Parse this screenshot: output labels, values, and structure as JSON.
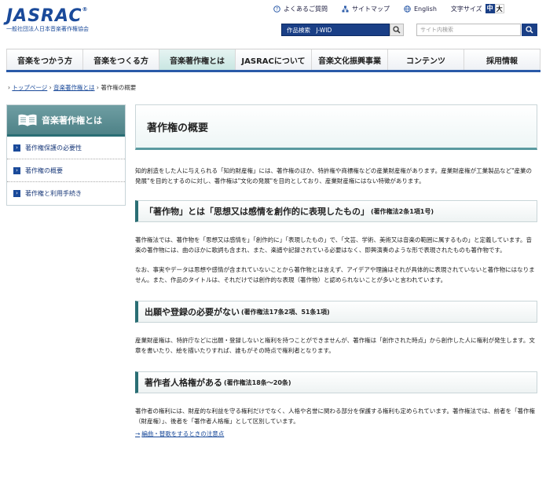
{
  "logo": {
    "main": "JASRAC",
    "mark": "®",
    "sub": "一般社団法人日本音楽著作権協会"
  },
  "toplinks": [
    {
      "icon": "question-icon",
      "label": "よくあるご質問"
    },
    {
      "icon": "sitemap-icon",
      "label": "サイトマップ"
    },
    {
      "icon": "globe-icon",
      "label": "English"
    }
  ],
  "fontsize": {
    "label": "文字サイズ",
    "mid": "中",
    "big": "大"
  },
  "search": {
    "works_label": "作品検索　J-WID",
    "site_placeholder": "サイト内検索"
  },
  "nav": [
    {
      "label": "音楽をつかう方"
    },
    {
      "label": "音楽をつくる方"
    },
    {
      "label": "音楽著作権とは"
    },
    {
      "label": "JASRACについて"
    },
    {
      "label": "音楽文化振興事業"
    },
    {
      "label": "コンテンツ"
    },
    {
      "label": "採用情報"
    }
  ],
  "breadcrumb": {
    "home": "トップページ",
    "parent": "音楽著作権とは",
    "current": "著作権の概要"
  },
  "sidebar": {
    "title": "音楽著作権とは",
    "items": [
      {
        "label": "著作権保護の必要性"
      },
      {
        "label": "著作権の概要"
      },
      {
        "label": "著作権と利用手続き"
      }
    ]
  },
  "main": {
    "title": "著作権の概要",
    "intro": "知的創造をした人に与えられる「知的財産権」には、著作権のほか、特許権や商標権などの産業財産権があります。産業財産権が工業製品など\"産業の発展\"を目的とするのに対し、著作権は\"文化の発展\"を目的としており、産業財産権にはない特徴があります。",
    "sections": [
      {
        "heading": "「著作物」とは「思想又は感情を創作的に表現したもの」",
        "heading_small": "(著作権法2条1項1号)",
        "paragraphs": [
          "著作権法では、著作物を「思想又は感情を」「創作的に」「表現したもの」で、「文芸、学術、美術又は音楽の範囲に属するもの」と定義しています。音楽の著作物には、曲のほかに歌詞も含まれ、また、楽譜や記録されている必要はなく、即興演奏のような形で表現されたものも著作物です。",
          "なお、事実やデータは思想や感情が含まれていないことから著作物とは言えず、アイデアや理論はそれが具体的に表現されていないと著作物にはなりません。また、作品のタイトルは、それだけでは創作的な表現（著作物）と認められないことが多いと言われています。"
        ]
      },
      {
        "heading": "出願や登録の必要がない",
        "heading_small": "(著作権法17条2項、51条1項)",
        "paragraphs": [
          "産業財産権は、特許庁などに出願・登録しないと権利を持つことができませんが、著作権は「創作された時点」から創作した人に権利が発生します。文章を書いたり、絵を描いたりすれば、誰もがその時点で権利者となります。"
        ]
      },
      {
        "heading": "著作者人格権がある",
        "heading_small": "(著作権法18条〜20条)",
        "paragraphs": [
          "著作者の権利には、財産的な利益を守る権利だけでなく、人格や名誉に関わる部分を保護する権利も定められています。著作権法では、前者を「著作権（財産権）」、後者を「著作者人格権」として区別しています。"
        ],
        "link": "編曲・替歌をするときの注意点"
      }
    ]
  }
}
